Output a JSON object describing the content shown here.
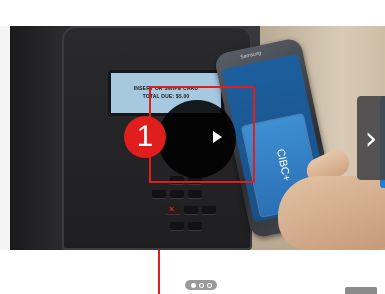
{
  "video": {
    "terminal_screen_line1": "INSERT OR SWIPE CARD",
    "terminal_screen_line2": "TOTAL DUE: $5.00",
    "phone_brand": "Samsung",
    "card_text": "CIBC+",
    "play_icon": "play-icon"
  },
  "annotation": {
    "badge_number": "1",
    "color": "#e01e1e"
  },
  "carousel": {
    "next_icon": "chevron-right-icon",
    "next_glyph": "›",
    "dots_total": 3,
    "active_dot": 1
  },
  "colors": {
    "accent_blue": "#1d7fd6",
    "terminal_screen": "#a6c9e0"
  }
}
